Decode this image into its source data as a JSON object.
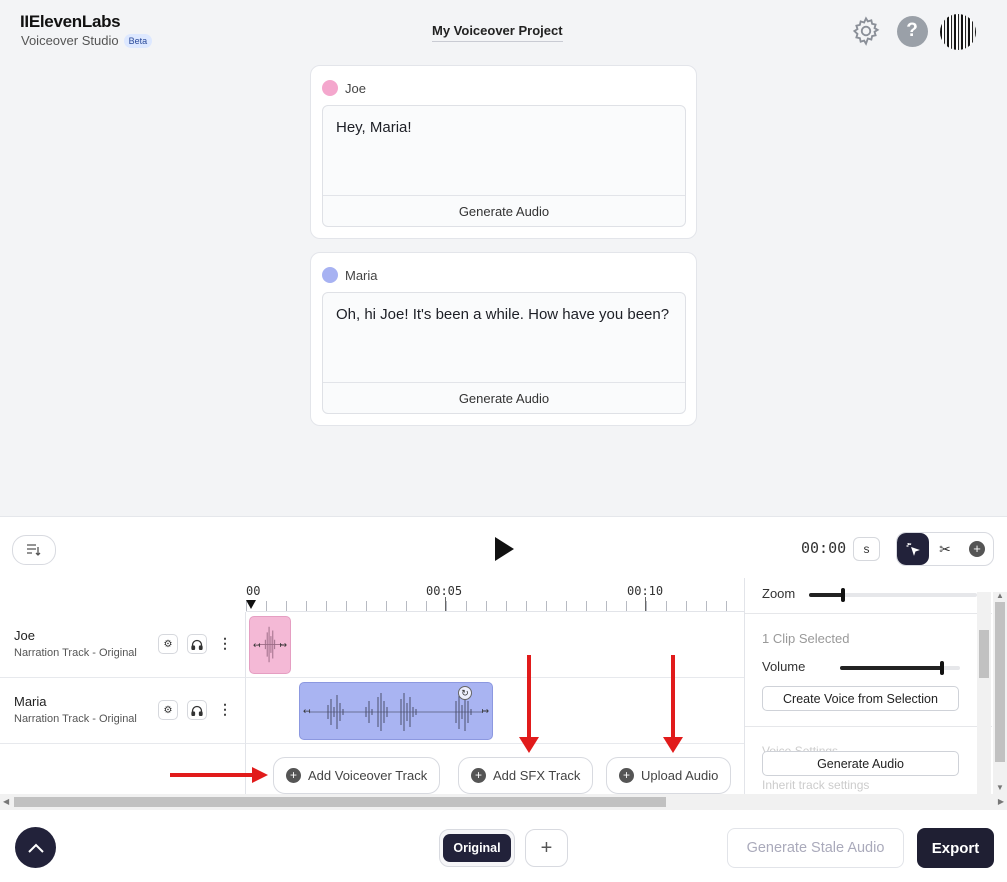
{
  "header": {
    "logo": "IIElevenLabs",
    "subtitle": "Voiceover Studio",
    "badge": "Beta",
    "project_title": "My Voiceover Project",
    "icons": [
      "gear-icon",
      "help-icon",
      "avatar"
    ]
  },
  "cards": [
    {
      "speaker": "Joe",
      "color": "#f4a7cd",
      "text": "Hey, Maria!",
      "button": "Generate Audio"
    },
    {
      "speaker": "Maria",
      "color": "#a7b2f2",
      "text": "Oh, hi Joe! It's been a while. How have you been?",
      "button": "Generate Audio"
    }
  ],
  "player": {
    "timecode": "00:00",
    "unit": "s"
  },
  "ruler": {
    "labels": [
      "00",
      "00:05",
      "00:10"
    ]
  },
  "tracks": [
    {
      "name": "Joe",
      "subtitle": "Narration Track - Original",
      "color": "#f4b9d6"
    },
    {
      "name": "Maria",
      "subtitle": "Narration Track - Original",
      "color": "#a9b4f2"
    }
  ],
  "add_buttons": {
    "voiceover": "Add Voiceover Track",
    "sfx": "Add SFX Track",
    "upload": "Upload Audio"
  },
  "side_panel": {
    "zoom_label": "Zoom",
    "zoom_level": 0.2,
    "clip_selected": "1 Clip Selected",
    "volume_label": "Volume",
    "volume_level": 0.85,
    "create_voice": "Create Voice from Selection",
    "voice_settings": "Voice Settings",
    "generate_audio": "Generate Audio",
    "inherit": "Inherit track settings"
  },
  "footer": {
    "version_label": "Original",
    "add_version": "+",
    "stale_button": "Generate Stale Audio",
    "export_button": "Export"
  },
  "colors": {
    "accent_dark": "#22223a",
    "annotation_arrow": "#e11b1b"
  }
}
